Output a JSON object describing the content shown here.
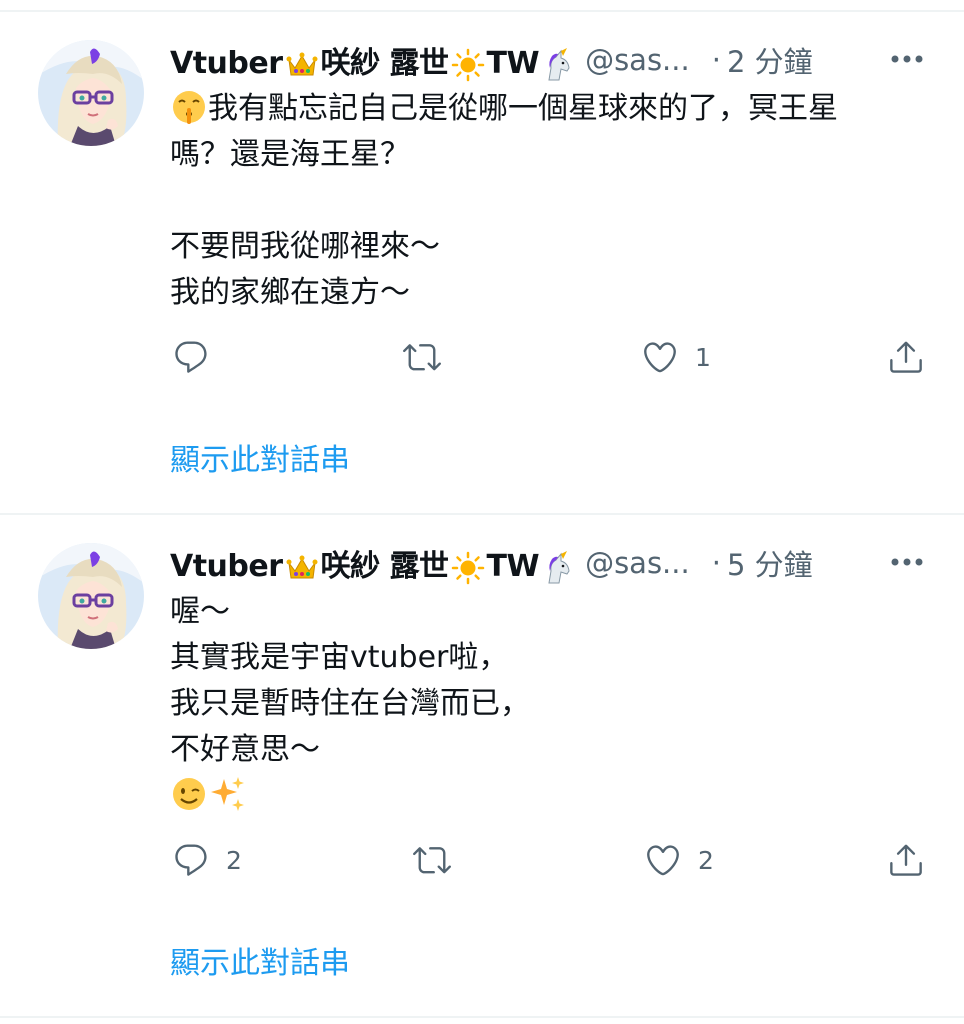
{
  "tweets": [
    {
      "display_name_prefix": "Vtuber",
      "display_name_mid": "咲紗 露世",
      "display_name_suffix": "TW",
      "handle": "@sas...",
      "separator": "·",
      "time": "2 分鐘",
      "lines": [
        "我有點忘記自己是從哪一個星球來的了，冥王星",
        "嗎？還是海王星？",
        "",
        "不要問我從哪裡來～",
        "我的家鄉在遠方～"
      ],
      "reply_count": "",
      "retweet_count": "",
      "like_count": "1",
      "thread_link": "顯示此對話串"
    },
    {
      "display_name_prefix": "Vtuber",
      "display_name_mid": "咲紗 露世",
      "display_name_suffix": "TW",
      "handle": "@sas...",
      "separator": "·",
      "time": "5 分鐘",
      "lines": [
        "喔～",
        "其實我是宇宙vtuber啦，",
        "我只是暫時住在台灣而已，",
        "不好意思～"
      ],
      "reply_count": "2",
      "retweet_count": "",
      "like_count": "2",
      "thread_link": "顯示此對話串"
    }
  ],
  "icons": {
    "name_icons": [
      "crown-icon",
      "sun-icon",
      "unicorn-icon"
    ],
    "first_tweet_leading_emoji": "shushing-face-icon",
    "second_tweet_emojis": [
      "winking-face-icon",
      "sparkles-icon"
    ],
    "actions": [
      "reply-icon",
      "retweet-icon",
      "like-icon",
      "share-icon"
    ],
    "more": "more-options-icon"
  },
  "colors": {
    "link": "#1d9bf0",
    "secondary_text": "#536471",
    "divider": "#eff3f4"
  }
}
